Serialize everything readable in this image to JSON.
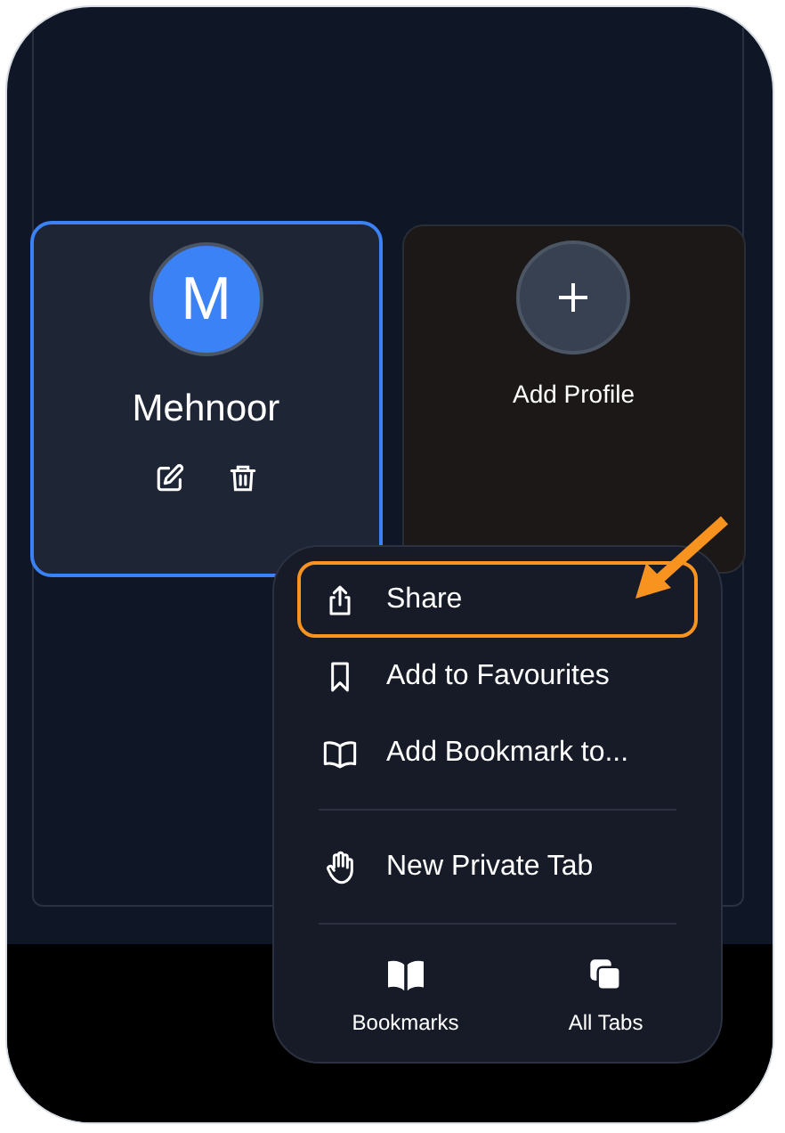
{
  "profiles": [
    {
      "initial": "M",
      "name": "Mehnoor",
      "selected": true
    }
  ],
  "add_profile": {
    "label": "Add Profile"
  },
  "menu": {
    "groups": [
      [
        {
          "label": "Share",
          "kind": "share",
          "highlighted": true
        },
        {
          "label": "Add to Favourites",
          "kind": "favourite",
          "highlighted": false
        },
        {
          "label": "Add Bookmark to...",
          "kind": "bookmark",
          "highlighted": false
        }
      ],
      [
        {
          "label": "New Private Tab",
          "kind": "private",
          "highlighted": false
        }
      ]
    ],
    "bottom_buttons": [
      {
        "label": "Bookmarks",
        "kind": "bookmarks"
      },
      {
        "label": "All Tabs",
        "kind": "tabs"
      }
    ]
  }
}
